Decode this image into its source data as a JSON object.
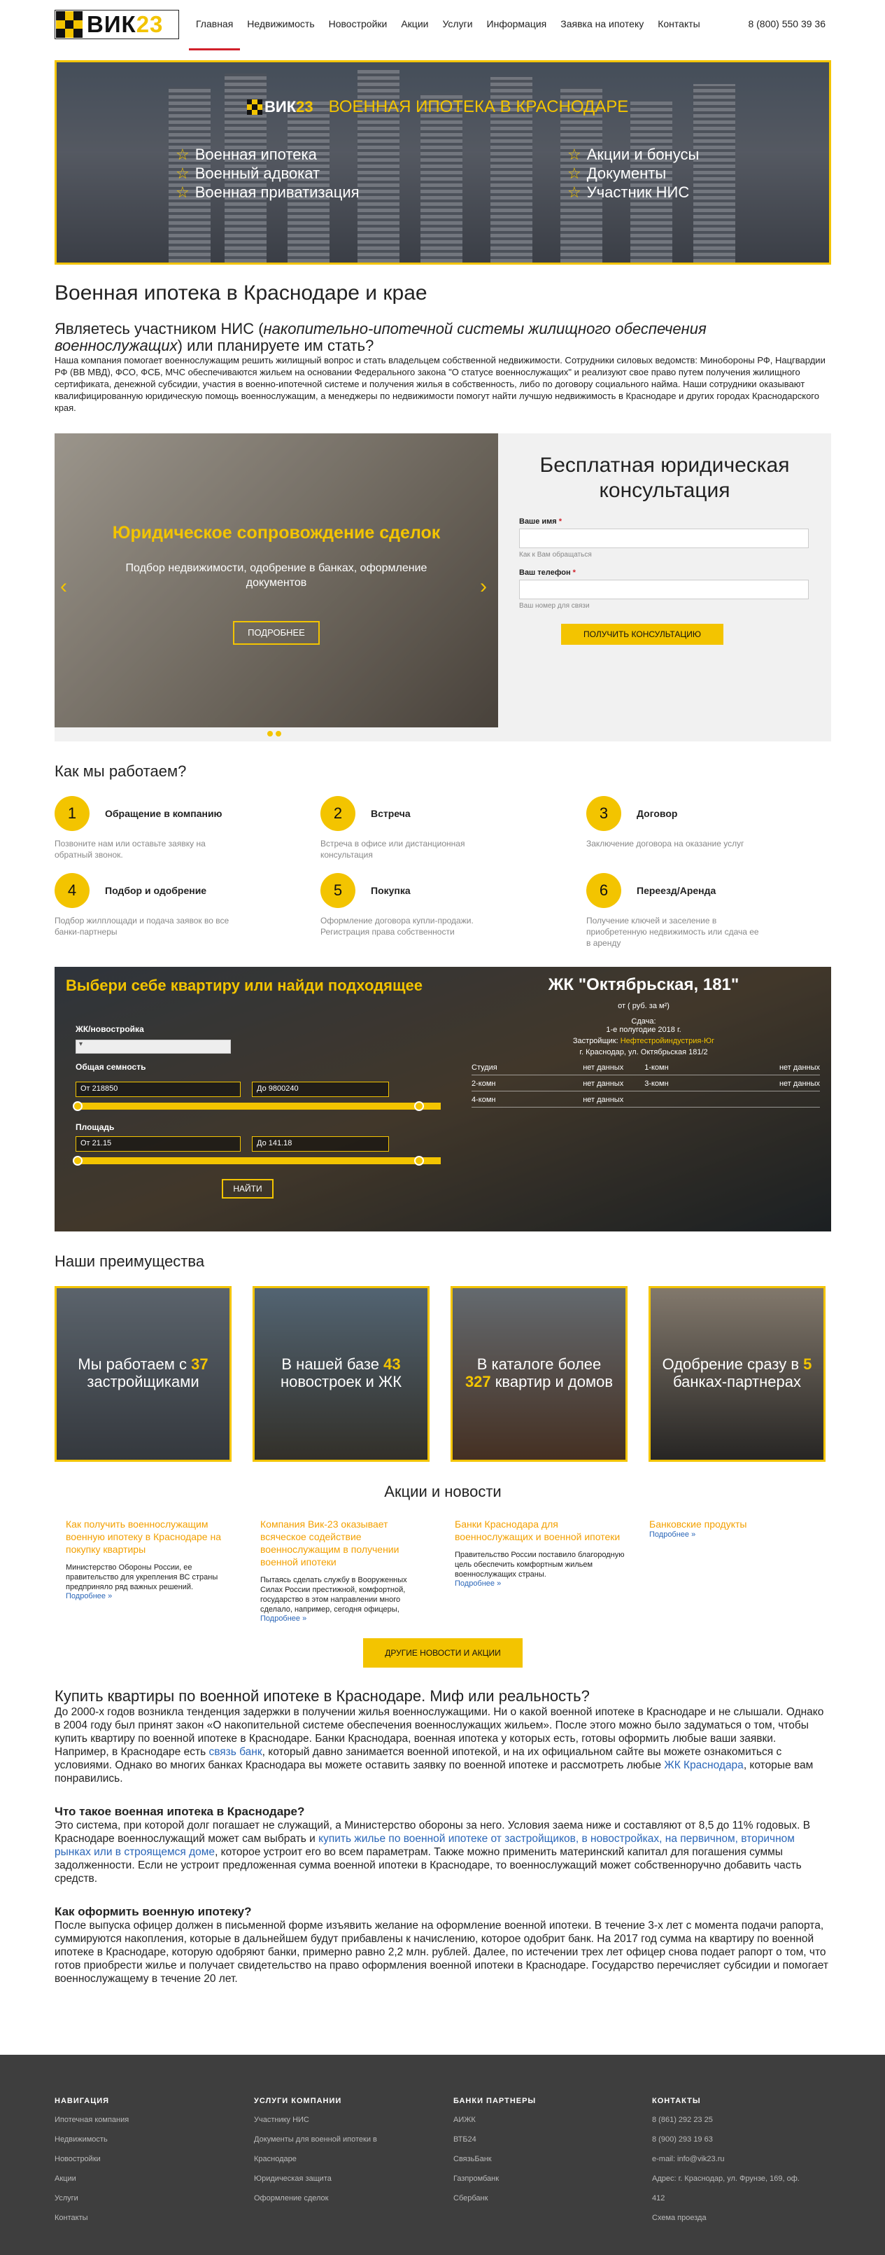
{
  "header": {
    "logo_text": "ВИК",
    "logo_num": "23",
    "nav": [
      "Главная",
      "Недвижимость",
      "Новостройки",
      "Акции",
      "Услуги",
      "Информация",
      "Заявка на ипотеку",
      "Контакты"
    ],
    "phone": "8 (800) 550 39 36"
  },
  "banner": {
    "logo_text": "ВИК",
    "logo_num": "23",
    "title": "ВОЕННАЯ ИПОТЕКА В КРАСНОДАРЕ",
    "left_items": [
      "Военная ипотека",
      "Военный адвокат",
      "Военная приватизация"
    ],
    "right_items": [
      "Акции и бонусы",
      "Документы",
      "Участник НИС"
    ]
  },
  "page": {
    "title": "Военная ипотека в Краснодаре и крае",
    "question_pre": "Являетесь участником НИС (",
    "question_em": "накопительно-ипотечной системы жилищного обеспечения военнослужащих",
    "question_post": ") или планируете им стать?",
    "intro": "Наша компания помогает военнослужащим решить жилищный вопрос и стать владельцем собственной недвижимости. Сотрудники силовых ведомств: Минобороны РФ, Нацгвардии РФ (ВВ МВД), ФСО, ФСБ, МЧС обеспечиваются жильем на основании Федерального закона \"О статусе военнослужащих\" и реализуют свое право путем получения жилищного сертификата, денежной субсидии, участия в военно-ипотечной системе и получения жилья в собственность, либо по договору социального найма. Наши сотрудники оказывают квалифицированную юридическую помощь военнослужащим, а менеджеры по недвижимости помогут найти лучшую недвижимость в Краснодаре и других городах Краснодарского края."
  },
  "slider": {
    "title": "Юридическое сопровождение сделок",
    "subtitle": "Подбор недвижимости, одобрение в банках, оформление документов",
    "button": "ПОДРОБНЕЕ"
  },
  "form": {
    "title": "Бесплатная юридическая консультация",
    "name_label": "Ваше имя",
    "name_hint": "Как к Вам обращаться",
    "phone_label": "Ваш телефон",
    "phone_hint": "Ваш номер для связи",
    "required": "*",
    "submit": "ПОЛУЧИТЬ КОНСУЛЬТАЦИЮ"
  },
  "how": {
    "title": "Как мы работаем?",
    "steps": [
      {
        "num": "1",
        "name": "Обращение в компанию",
        "desc": "Позвоните нам или оставьте заявку на обратный звонок."
      },
      {
        "num": "2",
        "name": "Встреча",
        "desc": "Встреча в офисе или дистанционная консультация"
      },
      {
        "num": "3",
        "name": "Договор",
        "desc": "Заключение договора на оказание услуг"
      },
      {
        "num": "4",
        "name": "Подбор и одобрение",
        "desc": "Подбор жилплощади и подача заявок во все банки-партнеры"
      },
      {
        "num": "5",
        "name": "Покупка",
        "desc": "Оформление договора купли-продажи. Регистрация права собственности"
      },
      {
        "num": "6",
        "name": "Переезд/Аренда",
        "desc": "Получение ключей и заселение в приобретенную недвижимость или сдача ее в аренду"
      }
    ]
  },
  "search": {
    "title": "Выбери себе квартиру или найди подходящее",
    "jk_label": "ЖК/новостройка",
    "area_label": "Общая семность",
    "area_from": "От  218850",
    "area_to": "До  9800240",
    "sq_label": "Площадь",
    "sq_from": "От  21.15",
    "sq_to": "До  141.18",
    "find": "НАЙТИ"
  },
  "jk": {
    "title": "ЖК \"Октябрьская, 181\"",
    "price": "от     ( руб. за м²)",
    "deadline_label": "Сдача:",
    "deadline": "1-е полугодие 2018 г.",
    "dev_label": "Застройщик:",
    "developer": "Нефтестройиндустрия-Юг",
    "address": "г. Краснодар, ул. Октябрьская 181/2",
    "rows": [
      [
        "Студия",
        "нет данных",
        "1-комн",
        "нет данных"
      ],
      [
        "2-комн",
        "нет данных",
        "3-комн",
        "нет данных"
      ],
      [
        "4-комн",
        "нет данных",
        "",
        ""
      ]
    ]
  },
  "adv": {
    "title": "Наши преимущества",
    "items": [
      {
        "pre": "Мы работаем с ",
        "num": "37",
        "post": " застройщиками"
      },
      {
        "pre": "В нашей базе ",
        "num": "43",
        "post": " новостроек и ЖК"
      },
      {
        "pre": "В каталоге более ",
        "num": "327",
        "post": " квартир и домов"
      },
      {
        "pre": "Одобрение сразу в ",
        "num": "5",
        "post": " банках-партнерах"
      }
    ]
  },
  "news": {
    "title": "Акции и новости",
    "items": [
      {
        "title": "Как получить военнослужащим военную ипотеку в Краснодаре на покупку квартиры",
        "text": "Министерство Обороны России, ее правительство для укрепления ВС страны предприняло ряд важных решений.",
        "more": "Подробнее »"
      },
      {
        "title": "Компания Вик-23 оказывает всяческое содействие военнослужащим в получении военной ипотеки",
        "text": "Пытаясь сделать службу в Вооруженных Силах России престижной, комфортной, государство в этом направлении много сделало, например, сегодня офицеры,",
        "more": "Подробнее »"
      },
      {
        "title": "Банки Краснодара для военнослужащих и военной ипотеки",
        "text": "Правительство России поставило благородную цель обеспечить комфортным жильем военнослужащих страны.",
        "more": "Подробнее »"
      },
      {
        "title": "Банковские продукты",
        "text": "",
        "more": "Подробнее »"
      }
    ],
    "button": "ДРУГИЕ НОВОСТИ И АКЦИИ"
  },
  "seo": {
    "h1": "Купить квартиры по военной ипотеке в Краснодаре. Миф или реальность?",
    "p1a": "До 2000-х годов возникла тенденция задержки в получении жилья военнослужащими. Ни о какой военной ипотеке в Краснодаре и не слышали. Однако в 2004 году был принят закон «О накопительной системе обеспечения военнослужащих жильем». После этого можно было задуматься о том, чтобы купить квартиру по военной ипотеке в Краснодаре. Банки Краснодара, военная ипотека у которых есть, готовы оформить любые ваши заявки. Например, в Краснодаре есть ",
    "p1link1": "связь банк",
    "p1b": ", который давно занимается военной ипотекой, и на их официальном сайте вы можете ознакомиться с условиями. Однако во многих банках Краснодара вы можете оставить заявку по военной ипотеке и рассмотреть любые ",
    "p1link2": "ЖК Краснодара",
    "p1c": ", которые вам понравились.",
    "h2": "Что такое военная ипотека в Краснодаре?",
    "p2a": "Это система, при которой долг погашает не служащий, а Министерство обороны за него. Условия заема ниже и составляют от 8,5 до 11% годовых. В Краснодаре военнослужащий может сам выбрать и ",
    "p2link": "купить жилье по военной ипотеке от застройщиков, в новостройках, на первичном, вторичном рынках или в строящемся доме",
    "p2b": ", которое устроит его во всем параметрам. Также можно применить материнский капитал для погашения суммы задолженности. Если не устроит предложенная сумма военной ипотеки в Краснодаре, то военнослужащий может собственноручно добавить часть средств.",
    "h3": "Как оформить военную ипотеку?",
    "p3": "После выпуска офицер должен в письменной форме изъявить желание на оформление военной ипотеки. В течение 3-х лет с момента подачи рапорта, суммируются накопления, которые в дальнейшем будут прибавлены к начислению, которое одобрит банк. На 2017 год сумма на квартиру по военной ипотеке в Краснодаре, которую одобряют банки, примерно равно 2,2 млн. рублей. Далее, по истечении трех лет офицер снова подает рапорт о том, что готов приобрести жилье и получает свидетельство на право оформления военной ипотеки в Краснодаре. Государство перечисляет субсидии и помогает военнослужащему в течение 20 лет."
  },
  "footer": {
    "cols": [
      {
        "head": "НАВИГАЦИЯ",
        "items": [
          "Ипотечная компания",
          "Недвижимость",
          "Новостройки",
          "Акции",
          "Услуги",
          "Контакты"
        ]
      },
      {
        "head": "УСЛУГИ КОМПАНИИ",
        "items": [
          "Участнику НИС",
          "Документы для военной ипотеки в",
          "Краснодаре",
          "Юридическая защита",
          "Оформление сделок"
        ]
      },
      {
        "head": "БАНКИ ПАРТНЕРЫ",
        "items": [
          "АИЖК",
          "ВТБ24",
          "СвязьБанк",
          "Газпромбанк",
          "Сбербанк"
        ]
      },
      {
        "head": "КОНТАКТЫ",
        "items": [
          "8 (861) 292 23 25",
          "8 (900) 293 19 63",
          "e-mail: info@vik23.ru",
          "Адрес: г. Краснодар, ул. Фрунзе, 169, оф.",
          "412",
          "Схема проезда"
        ]
      }
    ]
  },
  "colors": {
    "accent": "#f3c400",
    "nav_active": "#d1202a",
    "link": "#2a66b8",
    "footer_bg": "#3e3e3e"
  }
}
